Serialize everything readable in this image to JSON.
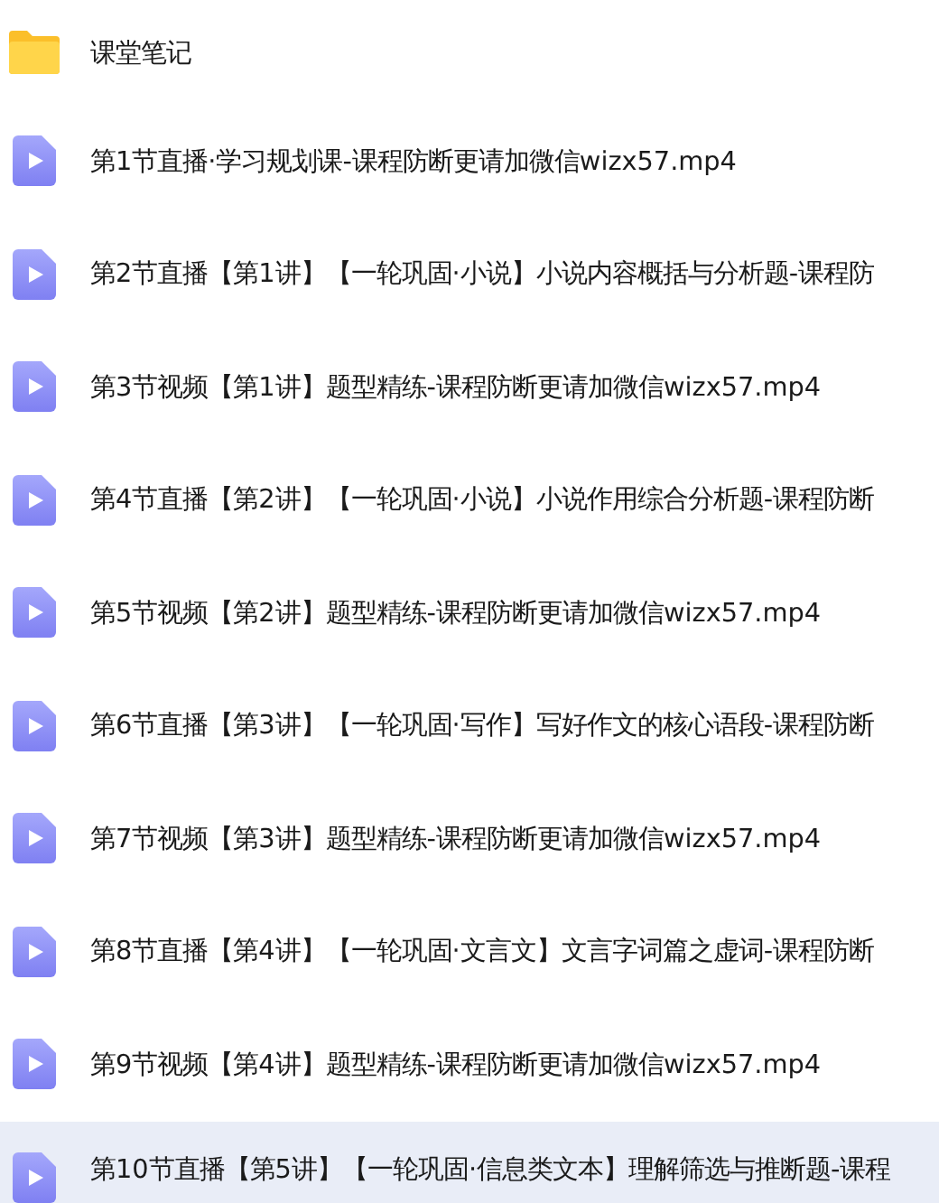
{
  "files": [
    {
      "kind": "folder",
      "name": "课堂笔记",
      "selected": false
    },
    {
      "kind": "video",
      "name": "第1节直播·学习规划课-课程防断更请加微信wizx57.mp4",
      "selected": false
    },
    {
      "kind": "video",
      "name": "第2节直播【第1讲】【一轮巩固·小说】小说内容概括与分析题-课程防",
      "selected": false
    },
    {
      "kind": "video",
      "name": "第3节视频【第1讲】题型精练-课程防断更请加微信wizx57.mp4",
      "selected": false
    },
    {
      "kind": "video",
      "name": "第4节直播【第2讲】【一轮巩固·小说】小说作用综合分析题-课程防断",
      "selected": false
    },
    {
      "kind": "video",
      "name": "第5节视频【第2讲】题型精练-课程防断更请加微信wizx57.mp4",
      "selected": false
    },
    {
      "kind": "video",
      "name": "第6节直播【第3讲】【一轮巩固·写作】写好作文的核心语段-课程防断",
      "selected": false
    },
    {
      "kind": "video",
      "name": "第7节视频【第3讲】题型精练-课程防断更请加微信wizx57.mp4",
      "selected": false
    },
    {
      "kind": "video",
      "name": "第8节直播【第4讲】【一轮巩固·文言文】文言字词篇之虚词-课程防断",
      "selected": false
    },
    {
      "kind": "video",
      "name": "第9节视频【第4讲】题型精练-课程防断更请加微信wizx57.mp4",
      "selected": false
    },
    {
      "kind": "video",
      "name": "第10节直播【第5讲】【一轮巩固·信息类文本】理解筛选与推断题-课程",
      "selected": true
    }
  ]
}
